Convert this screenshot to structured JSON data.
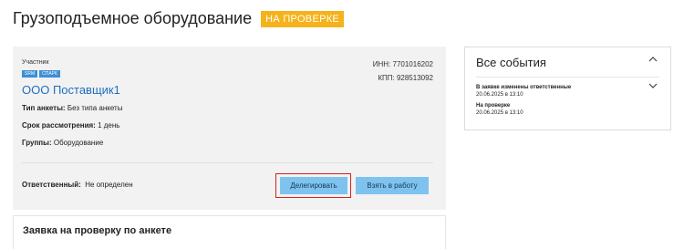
{
  "header": {
    "title": "Грузоподъемное оборудование",
    "status": "НА ПРОВЕРКЕ",
    "status_color": "#f5b21b"
  },
  "participant": {
    "label": "Участник",
    "tags": [
      "SRM",
      "СПАРК"
    ],
    "name": "ООО Поставщик1",
    "inn": "ИНН: 7701016202",
    "kpp": "КПП: 928513092",
    "form_type_label": "Тип анкеты:",
    "form_type_value": "Без типа анкеты",
    "review_term_label": "Срок рассмотрения:",
    "review_term_value": "1 день",
    "groups_label": "Группы:",
    "groups_value": "Оборудование",
    "responsible_label": "Ответственный:",
    "responsible_value": "Не определен",
    "delegate_button": "Делегировать",
    "take_button": "Взять в работу",
    "accent_color": "#7ec3ef",
    "link_color": "#1f6fc1"
  },
  "request": {
    "title": "Заявка на проверку по анкете"
  },
  "events": {
    "title": "Все события",
    "collapse_icon": "chevron-up-icon",
    "expand_icon": "chevron-down-icon",
    "items": [
      {
        "title": "В заявке изменены ответственные",
        "date": "20.06.2025 в 13:10"
      },
      {
        "title": "На проверке",
        "date": "20.06.2025 в 13:10"
      }
    ]
  }
}
